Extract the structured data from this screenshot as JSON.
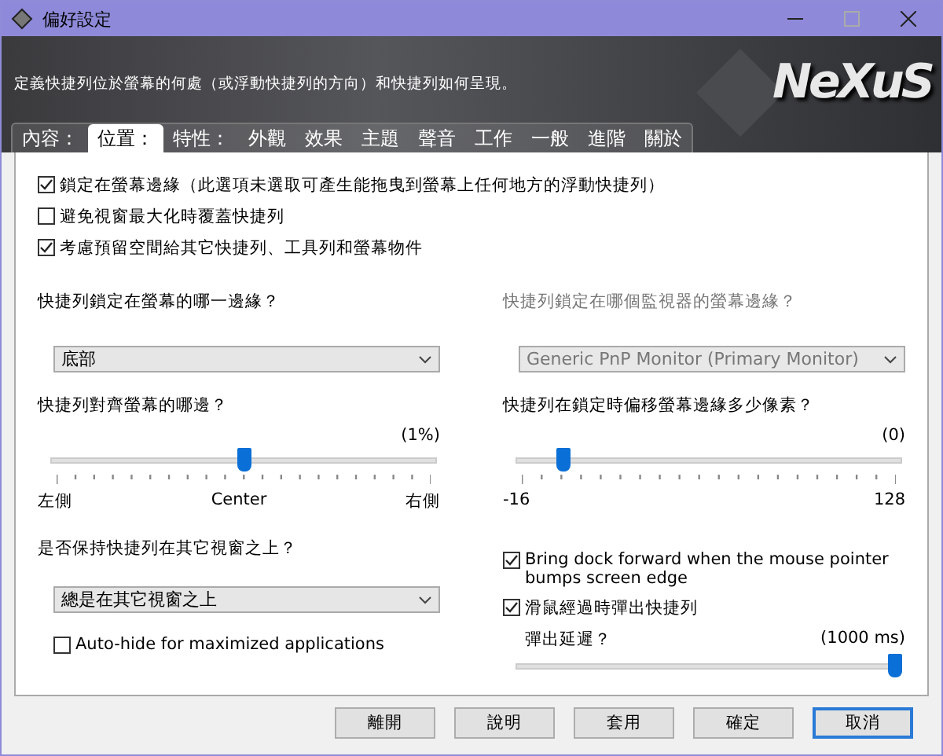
{
  "window": {
    "title": "偏好設定"
  },
  "header": {
    "description": "定義快捷列位於螢幕的何處（或浮動快捷列的方向）和快捷列如何呈現。",
    "logo": "NeXuS"
  },
  "tabs": [
    {
      "label": "內容：",
      "selected": false
    },
    {
      "label": "位置：",
      "selected": true
    },
    {
      "label": "特性：",
      "selected": false
    },
    {
      "label": "外觀",
      "selected": false
    },
    {
      "label": "效果",
      "selected": false
    },
    {
      "label": "主題",
      "selected": false
    },
    {
      "label": "聲音",
      "selected": false
    },
    {
      "label": "工作",
      "selected": false
    },
    {
      "label": "一般",
      "selected": false
    },
    {
      "label": "進階",
      "selected": false
    },
    {
      "label": "關於",
      "selected": false
    }
  ],
  "options": [
    {
      "label": "鎖定在螢幕邊緣（此選項未選取可產生能拖曳到螢幕上任何地方的浮動快捷列）",
      "checked": true
    },
    {
      "label": "避免視窗最大化時覆蓋快捷列",
      "checked": false
    },
    {
      "label": "考慮預留空間給其它快捷列、工具列和螢幕物件",
      "checked": true
    }
  ],
  "left": {
    "edge_label": "快捷列鎖定在螢幕的哪一邊緣？",
    "edge_value": "底部",
    "center_label": "快捷列對齊螢幕的哪邊？",
    "center_reading": "(1%)",
    "center_slider": {
      "level": 0.5,
      "marks": [
        "左側",
        "Center",
        "右側"
      ]
    },
    "ontop_label": "是否保持快捷列在其它視窗之上？",
    "ontop_value": "總是在其它視窗之上",
    "autohide": {
      "label": "Auto-hide for maximized applications",
      "checked": false
    }
  },
  "right": {
    "monitor_label": "快捷列鎖定在哪個監視器的螢幕邊緣？",
    "monitor_value": "Generic PnP Monitor (Primary Monitor)",
    "monitor_disabled": true,
    "offset_label": "快捷列在鎖定時偏移螢幕邊緣多少像素？",
    "offset_reading": "(0)",
    "offset_slider": {
      "level": 0.11,
      "marks": [
        "-16",
        "128"
      ]
    },
    "bring": {
      "label": "Bring dock forward when the mouse pointer bumps screen edge",
      "checked": true
    },
    "popup": {
      "label": "滑鼠經過時彈出快捷列",
      "checked": true
    },
    "delay_label": "彈出延遲？",
    "delay_reading": "(1000 ms)",
    "delay_slider": {
      "level": 1
    }
  },
  "buttons": [
    {
      "label": "離開",
      "default": false
    },
    {
      "label": "說明",
      "default": false
    },
    {
      "label": "套用",
      "default": false
    },
    {
      "label": "確定",
      "default": false
    },
    {
      "label": "取消",
      "default": true
    }
  ]
}
